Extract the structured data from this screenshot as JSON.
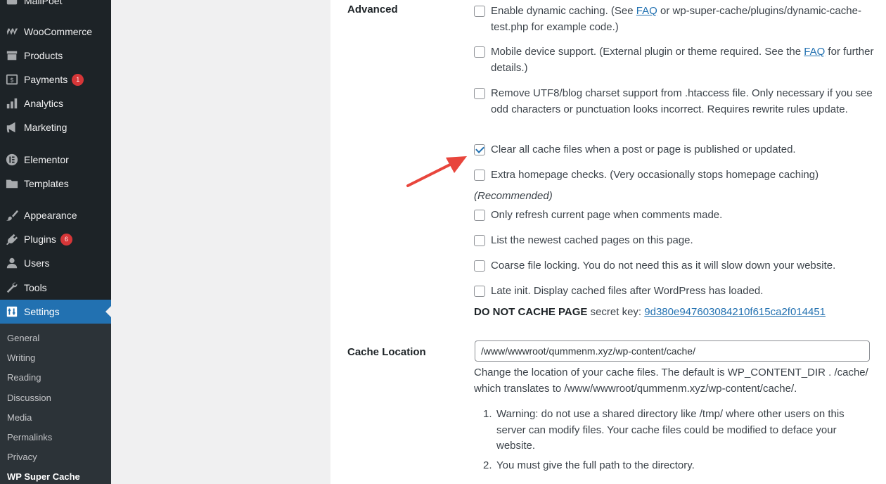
{
  "sidebar": {
    "items": [
      {
        "label": "MailPoet",
        "icon": "mailpoet-icon"
      },
      {
        "label": "WooCommerce",
        "icon": "woocommerce-icon"
      },
      {
        "label": "Products",
        "icon": "products-icon"
      },
      {
        "label": "Payments",
        "icon": "payments-icon",
        "badge": "1"
      },
      {
        "label": "Analytics",
        "icon": "analytics-icon"
      },
      {
        "label": "Marketing",
        "icon": "megaphone-icon"
      },
      {
        "label": "Elementor",
        "icon": "elementor-icon"
      },
      {
        "label": "Templates",
        "icon": "folder-icon"
      },
      {
        "label": "Appearance",
        "icon": "paintbrush-icon"
      },
      {
        "label": "Plugins",
        "icon": "plugin-icon",
        "badge": "6"
      },
      {
        "label": "Users",
        "icon": "user-icon"
      },
      {
        "label": "Tools",
        "icon": "wrench-icon"
      },
      {
        "label": "Settings",
        "icon": "settings-icon"
      }
    ],
    "submenu": [
      "General",
      "Writing",
      "Reading",
      "Discussion",
      "Media",
      "Permalinks",
      "Privacy",
      "WP Super Cache"
    ]
  },
  "advanced": {
    "label": "Advanced",
    "options": [
      {
        "pre": "Enable dynamic caching. (See ",
        "link": "FAQ",
        "post": " or wp-super-cache/plugins/dynamic-cache-test.php for example code.)",
        "checked": false
      },
      {
        "pre": "Mobile device support. (External plugin or theme required. See the ",
        "link": "FAQ",
        "post": " for further details.)",
        "checked": false
      },
      {
        "pre": "Remove UTF8/blog charset support from .htaccess file. Only necessary if you see odd characters or punctuation looks incorrect. Requires rewrite rules update.",
        "link": "",
        "post": "",
        "checked": false
      },
      {
        "pre": "Clear all cache files when a post or page is published or updated.",
        "link": "",
        "post": "",
        "checked": true
      },
      {
        "pre": "Extra homepage checks. (Very occasionally stops homepage caching)",
        "link": "",
        "post": "",
        "checked": false
      },
      {
        "pre": "Only refresh current page when comments made.",
        "link": "",
        "post": "",
        "checked": false
      },
      {
        "pre": "List the newest cached pages on this page.",
        "link": "",
        "post": "",
        "checked": false
      },
      {
        "pre": "Coarse file locking. You do not need this as it will slow down your website.",
        "link": "",
        "post": "",
        "checked": false
      },
      {
        "pre": "Late init. Display cached files after WordPress has loaded.",
        "link": "",
        "post": "",
        "checked": false
      }
    ],
    "recommended": "(Recommended)",
    "secret_key_bold": "DO NOT CACHE PAGE",
    "secret_key_text": " secret key: ",
    "secret_key_value": "9d380e947603084210f615ca2f014451"
  },
  "cache_location": {
    "label": "Cache Location",
    "value": "/www/wwwroot/qummenm.xyz/wp-content/cache/",
    "description": "Change the location of your cache files. The default is WP_CONTENT_DIR . /cache/ which translates to /www/wwwroot/qummenm.xyz/wp-content/cache/.",
    "warnings": [
      "Warning: do not use a shared directory like /tmp/ where other users on this server can modify files. Your cache files could be modified to deface your website.",
      "You must give the full path to the directory."
    ]
  },
  "colors": {
    "accent": "#2271b1",
    "sidebar": "#1d2327",
    "annotation_arrow": "#e8453c"
  }
}
